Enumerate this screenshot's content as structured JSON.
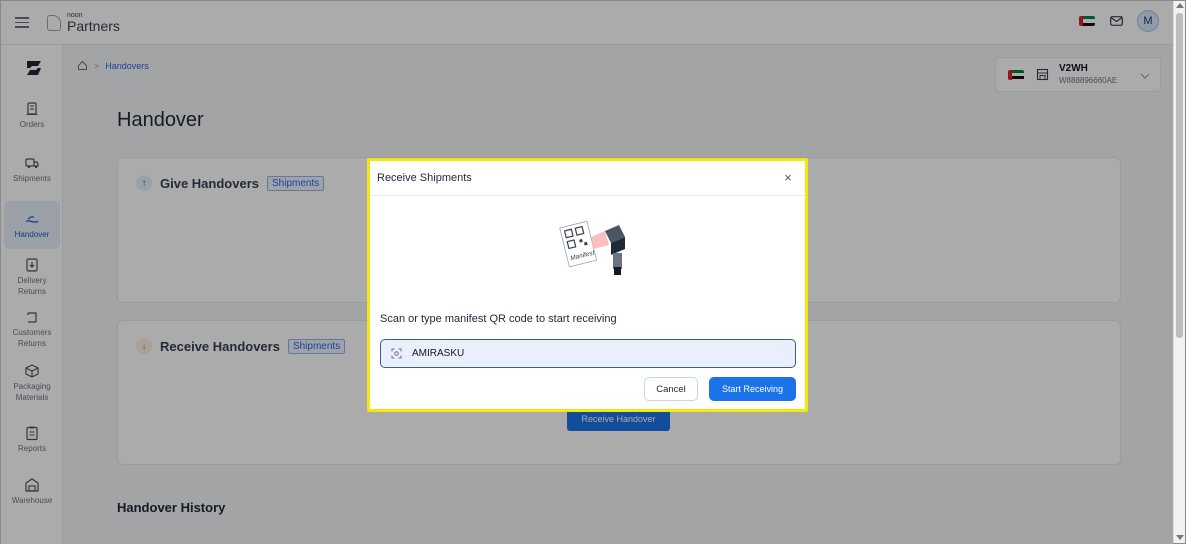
{
  "topbar": {
    "logo_small": "noon",
    "logo_big": "Partners",
    "avatar_initial": "M"
  },
  "sidebar": {
    "items": [
      {
        "label": "Orders",
        "icon": "orders-icon"
      },
      {
        "label": "Shipments",
        "icon": "truck-icon"
      },
      {
        "label": "Handover",
        "icon": "handover-icon",
        "active": true
      },
      {
        "label": "Delivery Returns",
        "icon": "delivery-returns-icon"
      },
      {
        "label": "Customers Returns",
        "icon": "customer-returns-icon"
      },
      {
        "label": "Packaging Materials",
        "icon": "package-icon"
      },
      {
        "label": "Reports",
        "icon": "reports-icon"
      },
      {
        "label": "Warehouse",
        "icon": "warehouse-icon"
      }
    ]
  },
  "breadcrumb": {
    "current": "Handovers"
  },
  "page": {
    "title": "Handover",
    "history_title": "Handover History"
  },
  "warehouse": {
    "code": "V2WH",
    "id": "W888896660AE"
  },
  "cards": {
    "give": {
      "title": "Give Handovers",
      "chip": "Shipments"
    },
    "receive": {
      "title": "Receive Handovers",
      "chip": "Shipments",
      "button": "Receive Handover"
    }
  },
  "modal": {
    "title": "Receive Shipments",
    "close": "×",
    "illustration_text": "Manifest",
    "scan_label": "Scan or type manifest QR code to start receiving",
    "input_value": "AMIRASKU",
    "cancel_label": "Cancel",
    "start_label": "Start Receiving"
  },
  "colors": {
    "primary": "#1a73e8",
    "modal_highlight": "#f5e60b",
    "uae_green": "#00843d",
    "uae_red": "#e11d2e"
  }
}
